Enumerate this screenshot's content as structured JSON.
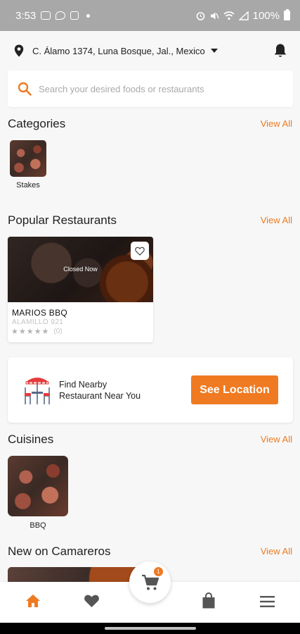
{
  "status_bar": {
    "time": "3:53",
    "battery": "100%"
  },
  "header": {
    "address": "C. Álamo 1374, Luna Bosque, Jal., Mexico",
    "location_icon": "map-pin-icon",
    "notifications_icon": "bell-icon"
  },
  "search": {
    "placeholder": "Search your desired foods or restaurants",
    "value": ""
  },
  "categories": {
    "title": "Categories",
    "view_all": "View All",
    "items": [
      {
        "label": "Stakes"
      }
    ]
  },
  "popular_restaurants": {
    "title": "Popular Restaurants",
    "view_all": "View All",
    "items": [
      {
        "status": "Closed Now",
        "name": "MARIOS BBQ",
        "address": "ALAMILLO 921",
        "stars": "★★★★★",
        "rating_count": "(0)",
        "rating": 0
      }
    ]
  },
  "find_nearby": {
    "line1": "Find Nearby",
    "line2": "Restaurant Near You",
    "button_label": "See Location"
  },
  "cuisines": {
    "title": "Cuisines",
    "view_all": "View All",
    "items": [
      {
        "label": "BBQ"
      }
    ]
  },
  "new_on": {
    "title": "New on Camareros",
    "view_all": "View All"
  },
  "bottom_nav": {
    "cart_count": "1",
    "items": [
      "home-icon",
      "heart-icon",
      "cart-icon",
      "shopping-bag-icon",
      "menu-icon"
    ]
  },
  "colors": {
    "accent": "#ef7a21",
    "background": "#f7f7f7",
    "status_bar": "#a8a8a8"
  }
}
